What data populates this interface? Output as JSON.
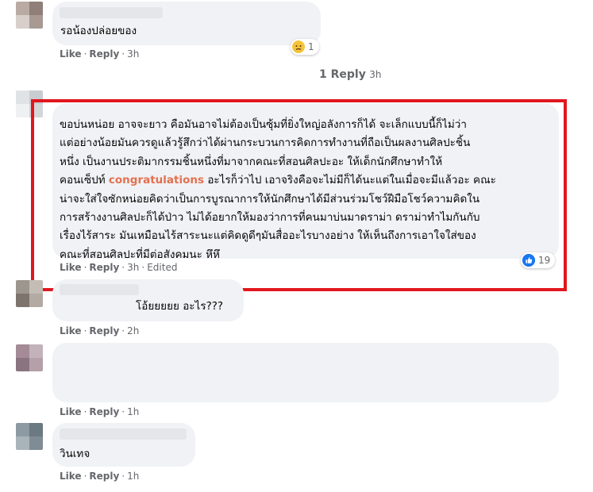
{
  "comments": [
    {
      "text": "รอน้องปล่อยของ",
      "like_label": "Like",
      "reply_label": "Reply",
      "time": "3h",
      "reaction": {
        "icon": "sad-face-icon",
        "count": "1",
        "color": "#f5c33b"
      }
    },
    {
      "view_replies": {
        "label": "1 Reply",
        "time": "3h"
      }
    },
    {
      "lines": [
        "ขอบ่นหน่อย อาจจะยาว คือมันอาจไม่ต้องเป็นซุ้มที่ยิ่งใหญ่อลังการก็ได้ จะเล็กแบบนี้ก็ไม่ว่า",
        "แต่อย่างน้อยมันควรดูแล้วรู้สึกว่าได้ผ่านกระบวนการคิดการทำงานที่ถือเป็นผลงานศิลปะชิ้น",
        "หนึ่ง เป็นงานประติมากรรมชิ้นหนึ่งที่มาจากคณะที่สอนศิลปะอะ ให้เด็กนักศึกษาทำให้"
      ],
      "line4_before": "คอนเซ็ปท์ ",
      "line4_highlight": "congratulations",
      "line4_after": " อะไรก็ว่าไป เอาจริงคือจะไม่มีก็ได้นะแต่ในเมื่อจะมีแล้วอะ คณะ",
      "lines_after": [
        "น่าจะใส่ใจซักหน่อยคิดว่าเป็นการบูรณาการให้นักศึกษาได้มีส่วนร่วมโชว์ฝีมือโชว์ความคิดใน",
        "การสร้างงานศิลปะก็ได้ป่าว ไม่ได้อยากให้มองว่าการที่คนมาบ่นมาดราม่า ดราม่าทำไมกันกับ",
        "เรื่องไร้สาระ มันเหมือนไร้สาระนะแต่คิดดูดีๆมันสื่ออะไรบางอย่าง ให้เห็นถึงการเอาใจใส่ของ",
        "คณะที่สอนศิลปะที่มีต่อสังคมนะ หึหึ"
      ],
      "like_label": "Like",
      "reply_label": "Reply",
      "time": "3h",
      "edited": "Edited",
      "reaction": {
        "icon": "like-icon",
        "count": "19",
        "color": "#1877f2"
      }
    },
    {
      "text": "โอ้ยยยยย อะไร???",
      "like_label": "Like",
      "reply_label": "Reply",
      "time": "2h"
    },
    {
      "like_label": "Like",
      "reply_label": "Reply",
      "time": "1h"
    },
    {
      "text": "วินเทจ",
      "like_label": "Like",
      "reply_label": "Reply",
      "time": "1h"
    }
  ]
}
